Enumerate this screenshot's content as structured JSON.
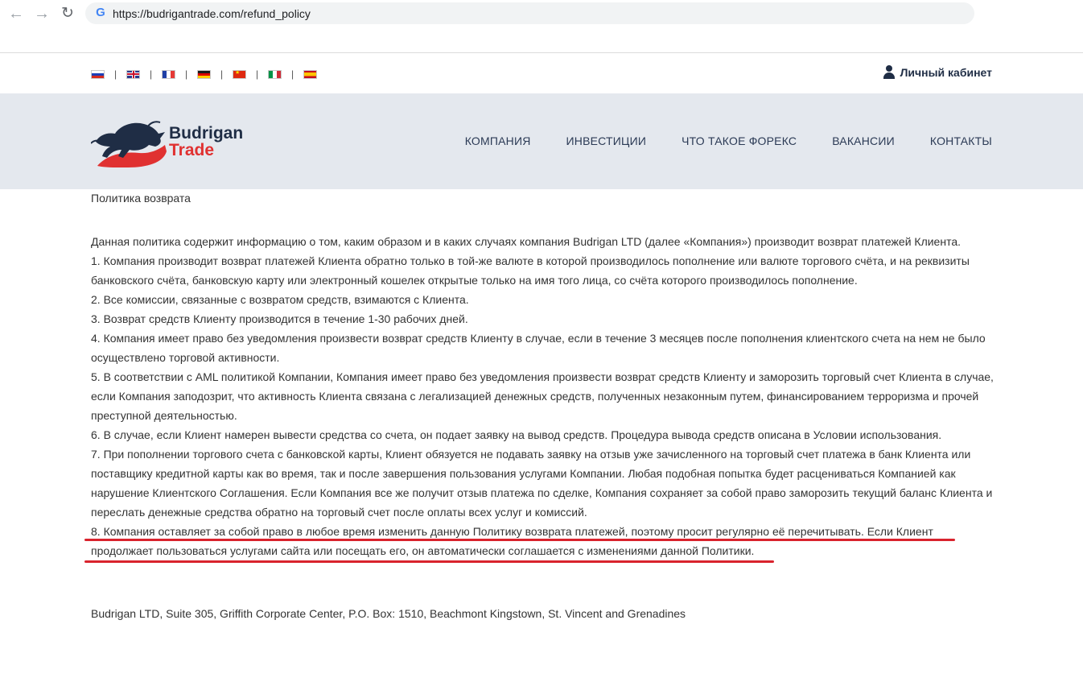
{
  "browser": {
    "url": "https://budrigantrade.com/refund_policy"
  },
  "topbar": {
    "languages": [
      "ru",
      "en",
      "fr",
      "de",
      "zh",
      "it",
      "es"
    ],
    "separator": "|",
    "account_label": "Личный кабинет"
  },
  "header": {
    "logo_line1": "Budrigan",
    "logo_line2": "Trade",
    "nav": [
      "КОМПАНИЯ",
      "ИНВЕСТИЦИИ",
      "ЧТО ТАКОЕ ФОРЕКС",
      "ВАКАНСИИ",
      "КОНТАКТЫ"
    ]
  },
  "content": {
    "title": "Политика возврата",
    "intro": "Данная политика содержит информацию о том, каким образом и в каких случаях компания Budrigan LTD (далее «Компания») производит возврат платежей Клиента.",
    "items": [
      "1. Компания производит возврат платежей Клиента обратно только в той-же валюте в которой производилось пополнение или валюте торгового счёта, и на реквизиты банковского счёта, банковскую карту или электронный кошелек открытые только на имя того лица, со счёта которого производилось пополнение.",
      "2. Все комиссии, связанные с возвратом средств, взимаются с Клиента.",
      "3. Возврат средств Клиенту производится в течение 1-30 рабочих дней.",
      "4. Компания имеет право без уведомления произвести возврат средств Клиенту в случае, если в течение 3 месяцев после пополнения клиентского счета на нем не было осуществлено торговой активности.",
      "5. В соответствии с AML политикой Компании, Компания имеет право без уведомления произвести возврат средств Клиенту и заморозить торговый счет Клиента в случае, если Компания заподозрит, что активность Клиента связана с легализацией денежных средств, полученных незаконным путем, финансированием терроризма и прочей преступной деятельностью.",
      "6. В случае, если Клиент намерен вывести средства со счета, он подает заявку на вывод средств. Процедура вывода средств описана в Условии использования.",
      "7. При пополнении торгового счета с банковской карты, Клиент обязуется не подавать заявку на отзыв уже зачисленного на торговый счет платежа в банк Клиента или поставщику кредитной карты как во время, так и после завершения пользования услугами Компании. Любая подобная попытка будет расцениваться Компанией как нарушение Клиентского Соглашения. Если Компания все же получит отзыв платежа по сделке, Компания сохраняет за собой право заморозить текущий баланс Клиента и переслать денежные средства обратно на торговый счет после оплаты всех услуг и комиссий.",
      "8. Компания оставляет за собой право в любое время изменить данную Политику возврата платежей, поэтому просит регулярно её перечитывать. Если Клиент продолжает пользоваться услугами сайта или посещать его, он автоматически соглашается с изменениями данной Политики."
    ],
    "address": "Budrigan LTD, Suite 305, Griffith Corporate Center, P.O. Box: 1510, Beachmont Kingstown, St. Vincent and Grenadines"
  },
  "colors": {
    "header_bg": "#e4e8ee",
    "brand_navy": "#1f2d45",
    "brand_red": "#e03131",
    "annotation_underline": "#d9232d"
  }
}
